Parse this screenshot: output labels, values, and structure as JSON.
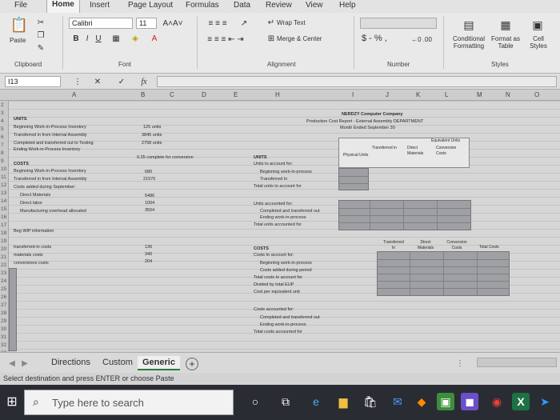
{
  "menu": {
    "tabs": [
      "File",
      "Home",
      "Insert",
      "Page Layout",
      "Formulas",
      "Data",
      "Review",
      "View",
      "Help"
    ]
  },
  "ribbon": {
    "paste_label": "Paste",
    "font_name": "Calibri",
    "font_size": "11",
    "wrap_text": "Wrap Text",
    "merge_center": "Merge & Center",
    "number_format_symbols": "$ - % ,",
    "conditional_formatting": "Conditional Formatting",
    "format_as_table": "Format as Table",
    "cell_styles": "Cell Styles",
    "groups": {
      "clipboard": "Clipboard",
      "font": "Font",
      "alignment": "Alignment",
      "number": "Number",
      "styles": "Styles"
    }
  },
  "formula_bar": {
    "name_box": "I13",
    "fx": "fx",
    "cancel": "✕",
    "enter": "✓",
    "value": ""
  },
  "columns": [
    "A",
    "B",
    "C",
    "D",
    "E",
    "H",
    "I",
    "J",
    "K",
    "L",
    "M",
    "N",
    "O"
  ],
  "rows": [
    "2",
    "3",
    "4",
    "5",
    "6",
    "7",
    "8",
    "9",
    "10",
    "11",
    "12",
    "13",
    "14",
    "15",
    "16",
    "17",
    "18",
    "19",
    "20",
    "21",
    "22",
    "23",
    "24",
    "25",
    "26",
    "27",
    "28",
    "29",
    "30",
    "31",
    "32",
    "33"
  ],
  "sheet": {
    "left": {
      "units_header": "UNITS",
      "beg_wip": "Beginning Work-in-Process Inventory",
      "transferred_in": "Transferred in from Internal Assembly",
      "completed": "Completed and transferred out to Testing",
      "ending_wip": "Ending Work-in-Process Inventory",
      "beg_wip_val": "125 units",
      "transferred_in_val": "3845 units",
      "completed_val": "2758 units",
      "pct_complete": "0.25 complete for conversion",
      "costs_header": "COSTS",
      "cost_beg_wip": "Beginning Work-in-Process Inventory",
      "cost_transferred": "Transferred in from Internal Assembly",
      "cost_added": "Costs added during September:",
      "dm": "Direct Materials",
      "dl": "Direct labor",
      "moh": "Manufacturing overhead allocated",
      "cost_beg_val": "680",
      "cost_trans_val": "21570",
      "dm_val": "5486",
      "dl_val": "1004",
      "moh_val": "3504",
      "beg_wip_info": "Beg WIP information",
      "transferred_costs": "transferred-in costs",
      "materials_costs": "materials costs",
      "conversion_costs": "conversions costs",
      "tic_val": "136",
      "mat_val": "340",
      "conv_val": "204"
    },
    "right": {
      "company": "NERDZY Computer Company",
      "report": "Production Cost Report - External Assembly DEPARTMENT",
      "period": "Month Ended September 30",
      "equiv_units": "Equivalent Units",
      "transferred_in": "Transferred in",
      "direct_materials": "Direct Materials",
      "conversion_costs": "Conversion Costs",
      "physical_units": "Physical Units",
      "units": "UNITS",
      "units_to_account": "Units to account for:",
      "beg_wip": "Beginning work-in-process",
      "transferred_in_row": "Transferred In",
      "total_units_to_account": "Total units to account for",
      "units_accounted": "Units accounted for:",
      "completed_out": "Completed and transferred out",
      "ending_wip": "Ending work-in-process",
      "total_units_accounted": "Total units accounted for",
      "costs_hdr_transferred": "Transferred In",
      "costs_hdr_dm": "Direct Materials",
      "costs_hdr_conv": "Conversion Costs",
      "costs_hdr_total": "Total Costs",
      "costs": "COSTS",
      "costs_to_account": "Costs to account for:",
      "cost_beg_wip": "Beginning work-in-process",
      "costs_added": "Costs added during period",
      "total_costs_to_account": "Total costs to account for",
      "divided_by": "Divided by total EUP",
      "cost_per_eu": "Cost per equivalent unit",
      "costs_accounted": "Costs accounted for:",
      "cost_completed_out": "Completed and transferred out",
      "cost_ending_wip": "Ending work-in-process",
      "total_costs_accounted": "Total costs accounted for"
    }
  },
  "sheet_tabs": [
    "Directions",
    "Custom",
    "Generic"
  ],
  "active_sheet": "Generic",
  "add_sheet": "+",
  "status": "Select destination and press ENTER or choose Paste",
  "taskbar": {
    "search_placeholder": "Type here to search"
  }
}
